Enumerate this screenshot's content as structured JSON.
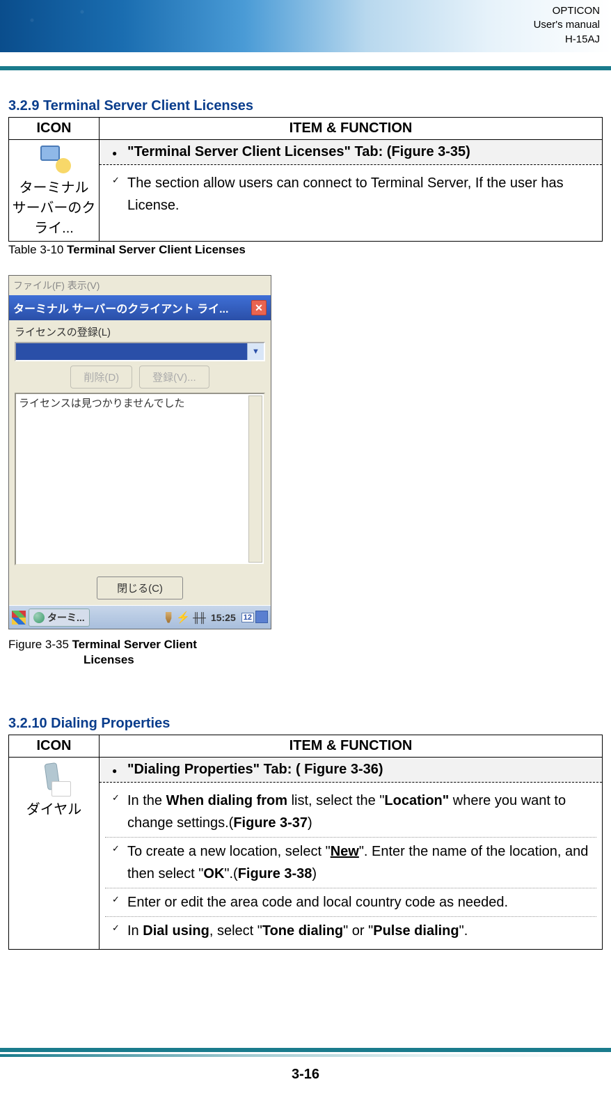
{
  "header": {
    "line1": "OPTICON",
    "line2": "User's manual",
    "line3": "H-15AJ"
  },
  "section1": {
    "heading": "3.2.9 Terminal Server Client Licenses",
    "table": {
      "col_icon": "ICON",
      "col_item": "ITEM & FUNCTION",
      "icon_label": "ターミナル サーバーのクライ...",
      "tab_title": "\"Terminal Server Client Licenses\" Tab: (Figure 3-35)",
      "desc": "The section allow users can connect to Terminal Server, If the user has License."
    },
    "caption_prefix": "Table 3-10 ",
    "caption_bold": "Terminal Server Client Licenses"
  },
  "figure": {
    "menubar": "ファイル(F)   表示(V)",
    "titlebar": "ターミナル サーバーのクライアント ライ...",
    "reg_label": "ライセンスの登録(L)",
    "btn_delete": "削除(D)",
    "btn_register": "登録(V)...",
    "list_text": "ライセンスは見つかりませんでした",
    "btn_close": "閉じる(C)",
    "task_label": "ターミ...",
    "clock": "15:25",
    "keyb": "12",
    "caption_prefix": "Figure 3-35 ",
    "caption_bold_l1": "Terminal Server Client",
    "caption_bold_l2": "Licenses"
  },
  "section2": {
    "heading": "3.2.10 Dialing Properties",
    "table": {
      "col_icon": "ICON",
      "col_item": "ITEM & FUNCTION",
      "icon_label": "ダイヤル",
      "tab_title": "\"Dialing Properties\" Tab: ( Figure 3-36)",
      "i1_a": "In the ",
      "i1_b": "When dialing from",
      "i1_c": " list, select the \"",
      "i1_d": "Location\"",
      "i1_e": " where you want to change settings.(",
      "i1_f": "Figure 3-37",
      "i1_g": ")",
      "i2_a": "To create a new location, select \"",
      "i2_b": "New",
      "i2_c": "\". Enter the name of the location, and then select \"",
      "i2_d": "OK",
      "i2_e": "\".(",
      "i2_f": "Figure 3-38",
      "i2_g": ")",
      "i3": "Enter or edit the area code and local country code as needed.",
      "i4_a": "In ",
      "i4_b": "Dial using",
      "i4_c": ", select \"",
      "i4_d": "Tone dialing",
      "i4_e": "\" or \"",
      "i4_f": "Pulse dialing",
      "i4_g": "\"."
    }
  },
  "page_number": "3-16"
}
